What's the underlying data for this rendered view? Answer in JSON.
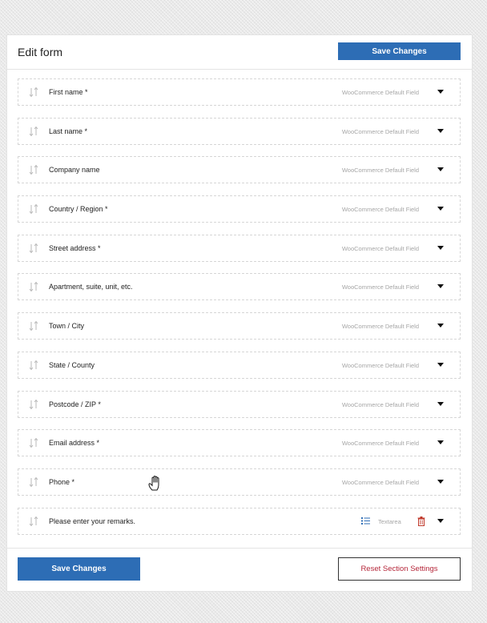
{
  "header": {
    "title": "Edit form",
    "save_label": "Save Changes"
  },
  "fields": [
    {
      "label": "First name *",
      "meta": "WooCommerce Default Field"
    },
    {
      "label": "Last name *",
      "meta": "WooCommerce Default Field"
    },
    {
      "label": "Company name",
      "meta": "WooCommerce Default Field"
    },
    {
      "label": "Country / Region *",
      "meta": "WooCommerce Default Field"
    },
    {
      "label": "Street address *",
      "meta": "WooCommerce Default Field"
    },
    {
      "label": "Apartment, suite, unit, etc.",
      "meta": "WooCommerce Default Field"
    },
    {
      "label": "Town / City",
      "meta": "WooCommerce Default Field"
    },
    {
      "label": "State / County",
      "meta": "WooCommerce Default Field"
    },
    {
      "label": "Postcode / ZIP *",
      "meta": "WooCommerce Default Field"
    },
    {
      "label": "Email address *",
      "meta": "WooCommerce Default Field"
    },
    {
      "label": "Phone *",
      "meta": "WooCommerce Default Field"
    }
  ],
  "custom_field": {
    "label": "Please enter your remarks.",
    "type_label": "Textarea",
    "type_icon": "list-icon",
    "delete_icon": "trash-icon"
  },
  "footer": {
    "save_label": "Save Changes",
    "reset_label": "Reset Section Settings"
  },
  "colors": {
    "primary": "#2d6db5",
    "danger": "#b5273a",
    "muted": "#a6a6a6"
  }
}
